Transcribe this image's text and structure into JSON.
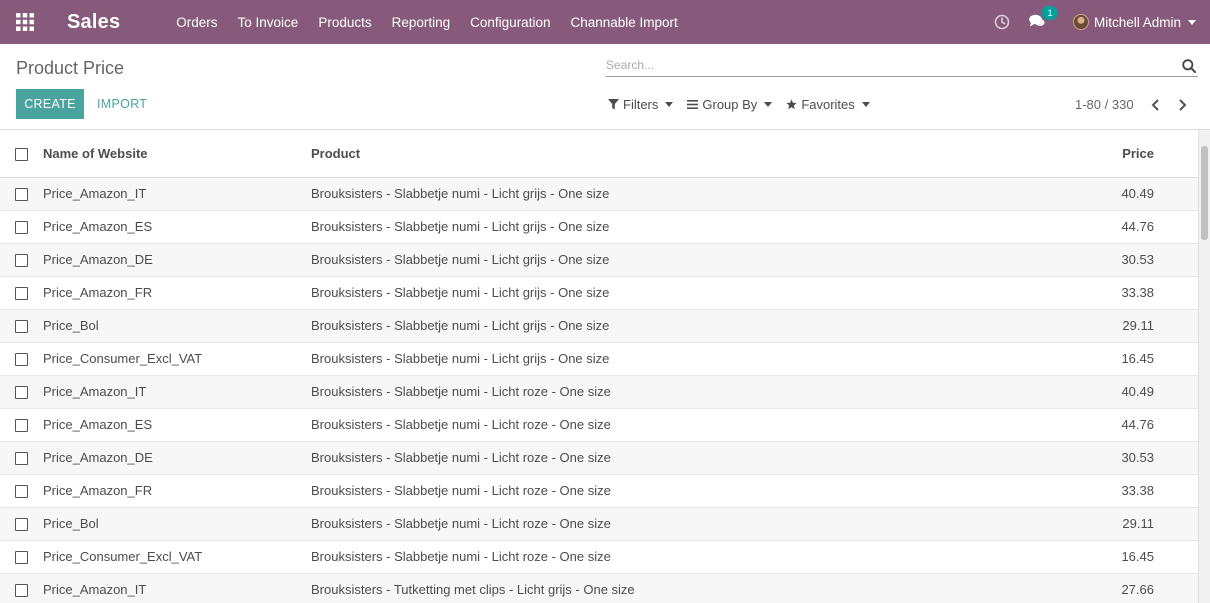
{
  "navbar": {
    "app_name": "Sales",
    "menu": [
      "Orders",
      "To Invoice",
      "Products",
      "Reporting",
      "Configuration",
      "Channable Import"
    ],
    "messages_badge": "1",
    "user_name": "Mitchell Admin",
    "bg_color": "#875a7b",
    "icons": [
      "apps-grid-icon",
      "clock-icon",
      "chat-icon",
      "avatar"
    ]
  },
  "control_panel": {
    "title": "Product Price",
    "search_placeholder": "Search...",
    "create_label": "CREATE",
    "import_label": "IMPORT",
    "filters_label": "Filters",
    "group_by_label": "Group By",
    "favorites_label": "Favorites",
    "pager_value": "1-80 / 330",
    "accent_color": "#4ba39f"
  },
  "table": {
    "columns": [
      "Name of Website",
      "Product",
      "Price"
    ],
    "rows": [
      {
        "name": "Price_Amazon_IT",
        "product": "Brouksisters - Slabbetje numi - Licht grijs - One size",
        "price": "40.49"
      },
      {
        "name": "Price_Amazon_ES",
        "product": "Brouksisters - Slabbetje numi - Licht grijs - One size",
        "price": "44.76"
      },
      {
        "name": "Price_Amazon_DE",
        "product": "Brouksisters - Slabbetje numi - Licht grijs - One size",
        "price": "30.53"
      },
      {
        "name": "Price_Amazon_FR",
        "product": "Brouksisters - Slabbetje numi - Licht grijs - One size",
        "price": "33.38"
      },
      {
        "name": "Price_Bol",
        "product": "Brouksisters - Slabbetje numi - Licht grijs - One size",
        "price": "29.11"
      },
      {
        "name": "Price_Consumer_Excl_VAT",
        "product": "Brouksisters - Slabbetje numi - Licht grijs - One size",
        "price": "16.45"
      },
      {
        "name": "Price_Amazon_IT",
        "product": "Brouksisters - Slabbetje numi - Licht roze - One size",
        "price": "40.49"
      },
      {
        "name": "Price_Amazon_ES",
        "product": "Brouksisters - Slabbetje numi - Licht roze - One size",
        "price": "44.76"
      },
      {
        "name": "Price_Amazon_DE",
        "product": "Brouksisters - Slabbetje numi - Licht roze - One size",
        "price": "30.53"
      },
      {
        "name": "Price_Amazon_FR",
        "product": "Brouksisters - Slabbetje numi - Licht roze - One size",
        "price": "33.38"
      },
      {
        "name": "Price_Bol",
        "product": "Brouksisters - Slabbetje numi - Licht roze - One size",
        "price": "29.11"
      },
      {
        "name": "Price_Consumer_Excl_VAT",
        "product": "Brouksisters - Slabbetje numi - Licht roze - One size",
        "price": "16.45"
      },
      {
        "name": "Price_Amazon_IT",
        "product": "Brouksisters - Tutketting met clips - Licht grijs - One size",
        "price": "27.66"
      }
    ]
  }
}
